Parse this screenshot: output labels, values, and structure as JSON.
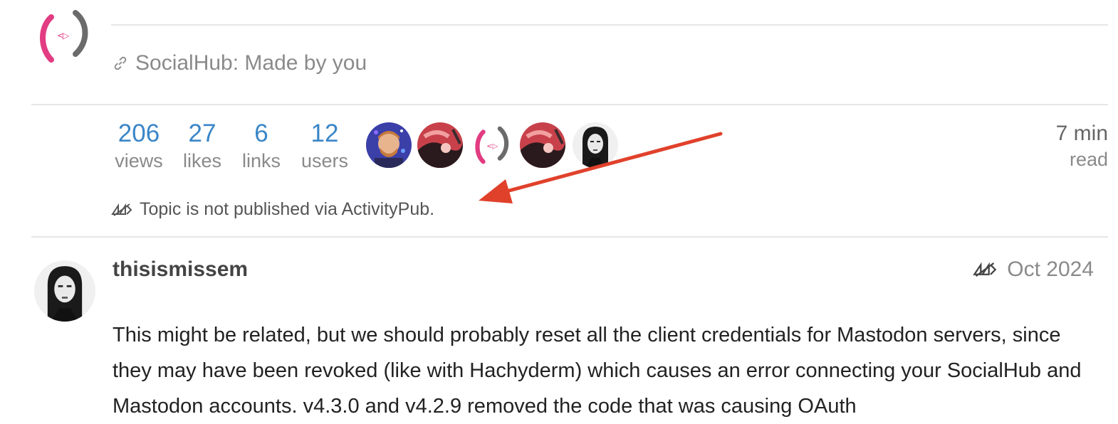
{
  "header": {
    "link_text": "SocialHub: Made by you"
  },
  "topic_stats": [
    {
      "value": "206",
      "label": "views"
    },
    {
      "value": "27",
      "label": "likes"
    },
    {
      "value": "6",
      "label": "links"
    },
    {
      "value": "12",
      "label": "users"
    }
  ],
  "participants": [
    "avatar-1",
    "avatar-2",
    "socialhub-logo",
    "avatar-4",
    "avatar-5"
  ],
  "read_time": {
    "value": "7 min",
    "label": "read"
  },
  "activitypub_status": "Topic is not published via ActivityPub.",
  "post": {
    "username": "thisismissem",
    "date": "Oct 2024",
    "body": "This might be related, but we should probably reset all the client credentials for Mastodon servers, since they may have been revoked (like with Hachyderm) which causes an error connecting your SocialHub and Mastodon accounts. v4.3.0 and v4.2.9 removed the code that was causing OAuth"
  },
  "colors": {
    "accent": "#3a86c8",
    "logo_pink": "#e23c82",
    "logo_gray": "#6b6b6b",
    "annotation_arrow": "#e0412b"
  }
}
